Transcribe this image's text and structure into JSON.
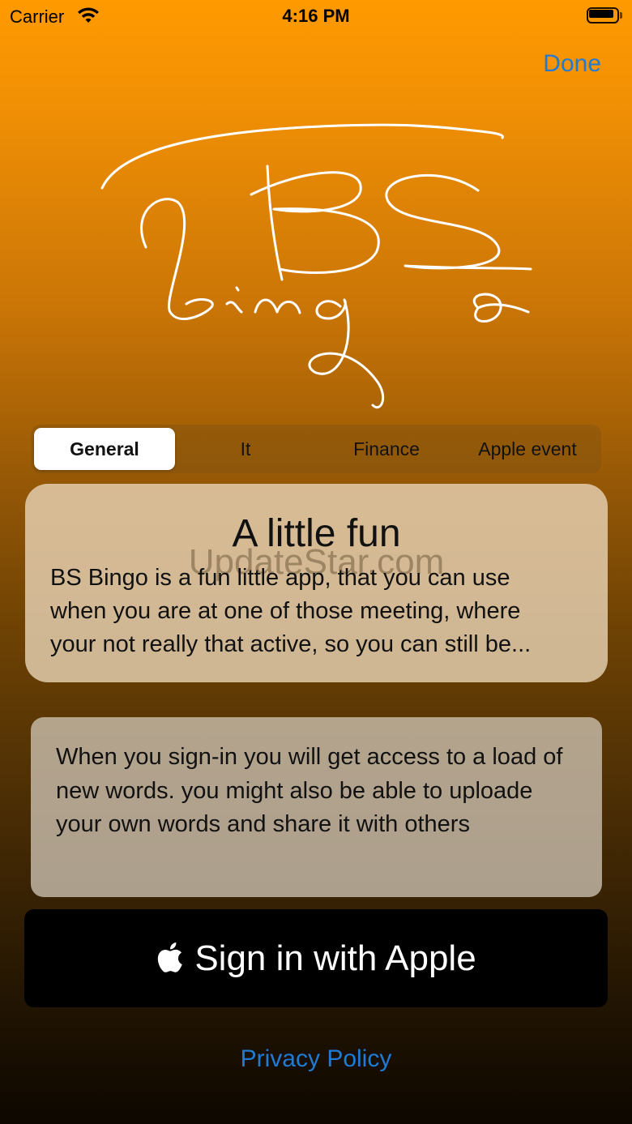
{
  "status_bar": {
    "carrier": "Carrier",
    "time": "4:16 PM",
    "icons": [
      "wifi-icon",
      "battery-icon"
    ]
  },
  "nav": {
    "done_label": "Done"
  },
  "logo": {
    "text": "BS bingo"
  },
  "segments": {
    "items": [
      "General",
      "It",
      "Finance",
      "Apple event"
    ],
    "selected": "General"
  },
  "info_card": {
    "title": "A little fun",
    "body": "BS Bingo is a fun little app, that you can use when you are at one of those meeting, where your not really that active, so you can still be...",
    "line1": "BS Bingo is a fun little app, that you can use",
    "line2": "when you are at one of those meeting, where",
    "line3": "your not really that active, so you can still be...",
    "watermark": "UpdateStar.com"
  },
  "signin_info": {
    "text": "When you sign-in you will get access to a load of new words. you might also be able to uploade your own words and share it with others"
  },
  "apple_button": {
    "label": "Sign in with Apple",
    "icon": "apple-logo-icon"
  },
  "footer": {
    "privacy_label": "Privacy Policy"
  },
  "colors": {
    "accent": "#1f7bd6",
    "gradient_top": "#ff9a00",
    "gradient_bottom": "#0d0700"
  }
}
